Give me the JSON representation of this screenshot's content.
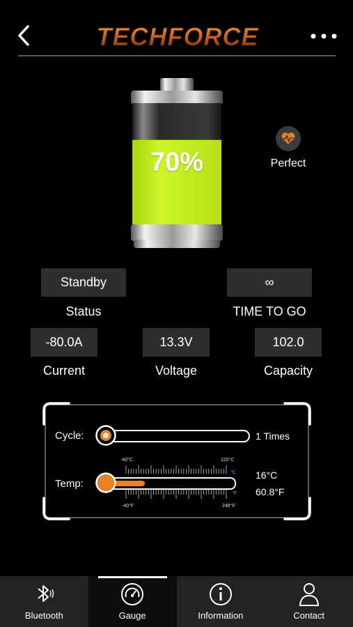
{
  "header": {
    "title": "TECHFORCE",
    "back_icon": "chevron-left-icon",
    "menu_icon": "more-horizontal-icon"
  },
  "battery": {
    "percent_label": "70%",
    "level": 0.7,
    "health_label": "Perfect",
    "health_icon": "heart-pulse-icon",
    "colors": {
      "fill": "#c6f01c",
      "accent": "#e8822a"
    }
  },
  "metrics": {
    "status": {
      "value": "Standby",
      "label": "Status"
    },
    "time_to_go": {
      "value": "∞",
      "label": "TIME TO GO"
    },
    "current": {
      "value": "-80.0A",
      "label": "Current"
    },
    "voltage": {
      "value": "13.3V",
      "label": "Voltage"
    },
    "capacity": {
      "value": "102.0",
      "label": "Capacity"
    }
  },
  "gauges": {
    "cycle": {
      "label": "Cycle:",
      "value_text": "1 Times"
    },
    "temp": {
      "label": "Temp:",
      "celsius": "16°C",
      "fahrenheit": "60.8°F",
      "scale_c_min": "-40°C",
      "scale_c_max": "120°C",
      "scale_f_min": "-40°F",
      "scale_f_max": "248°F",
      "unit_c": "°C",
      "unit_f": "°F",
      "level": 0.35
    }
  },
  "nav": {
    "tabs": [
      {
        "label": "Bluetooth",
        "icon": "bluetooth-icon",
        "active": false
      },
      {
        "label": "Gauge",
        "icon": "gauge-icon",
        "active": true
      },
      {
        "label": "Information",
        "icon": "info-icon",
        "active": false
      },
      {
        "label": "Contact",
        "icon": "person-icon",
        "active": false
      }
    ]
  }
}
